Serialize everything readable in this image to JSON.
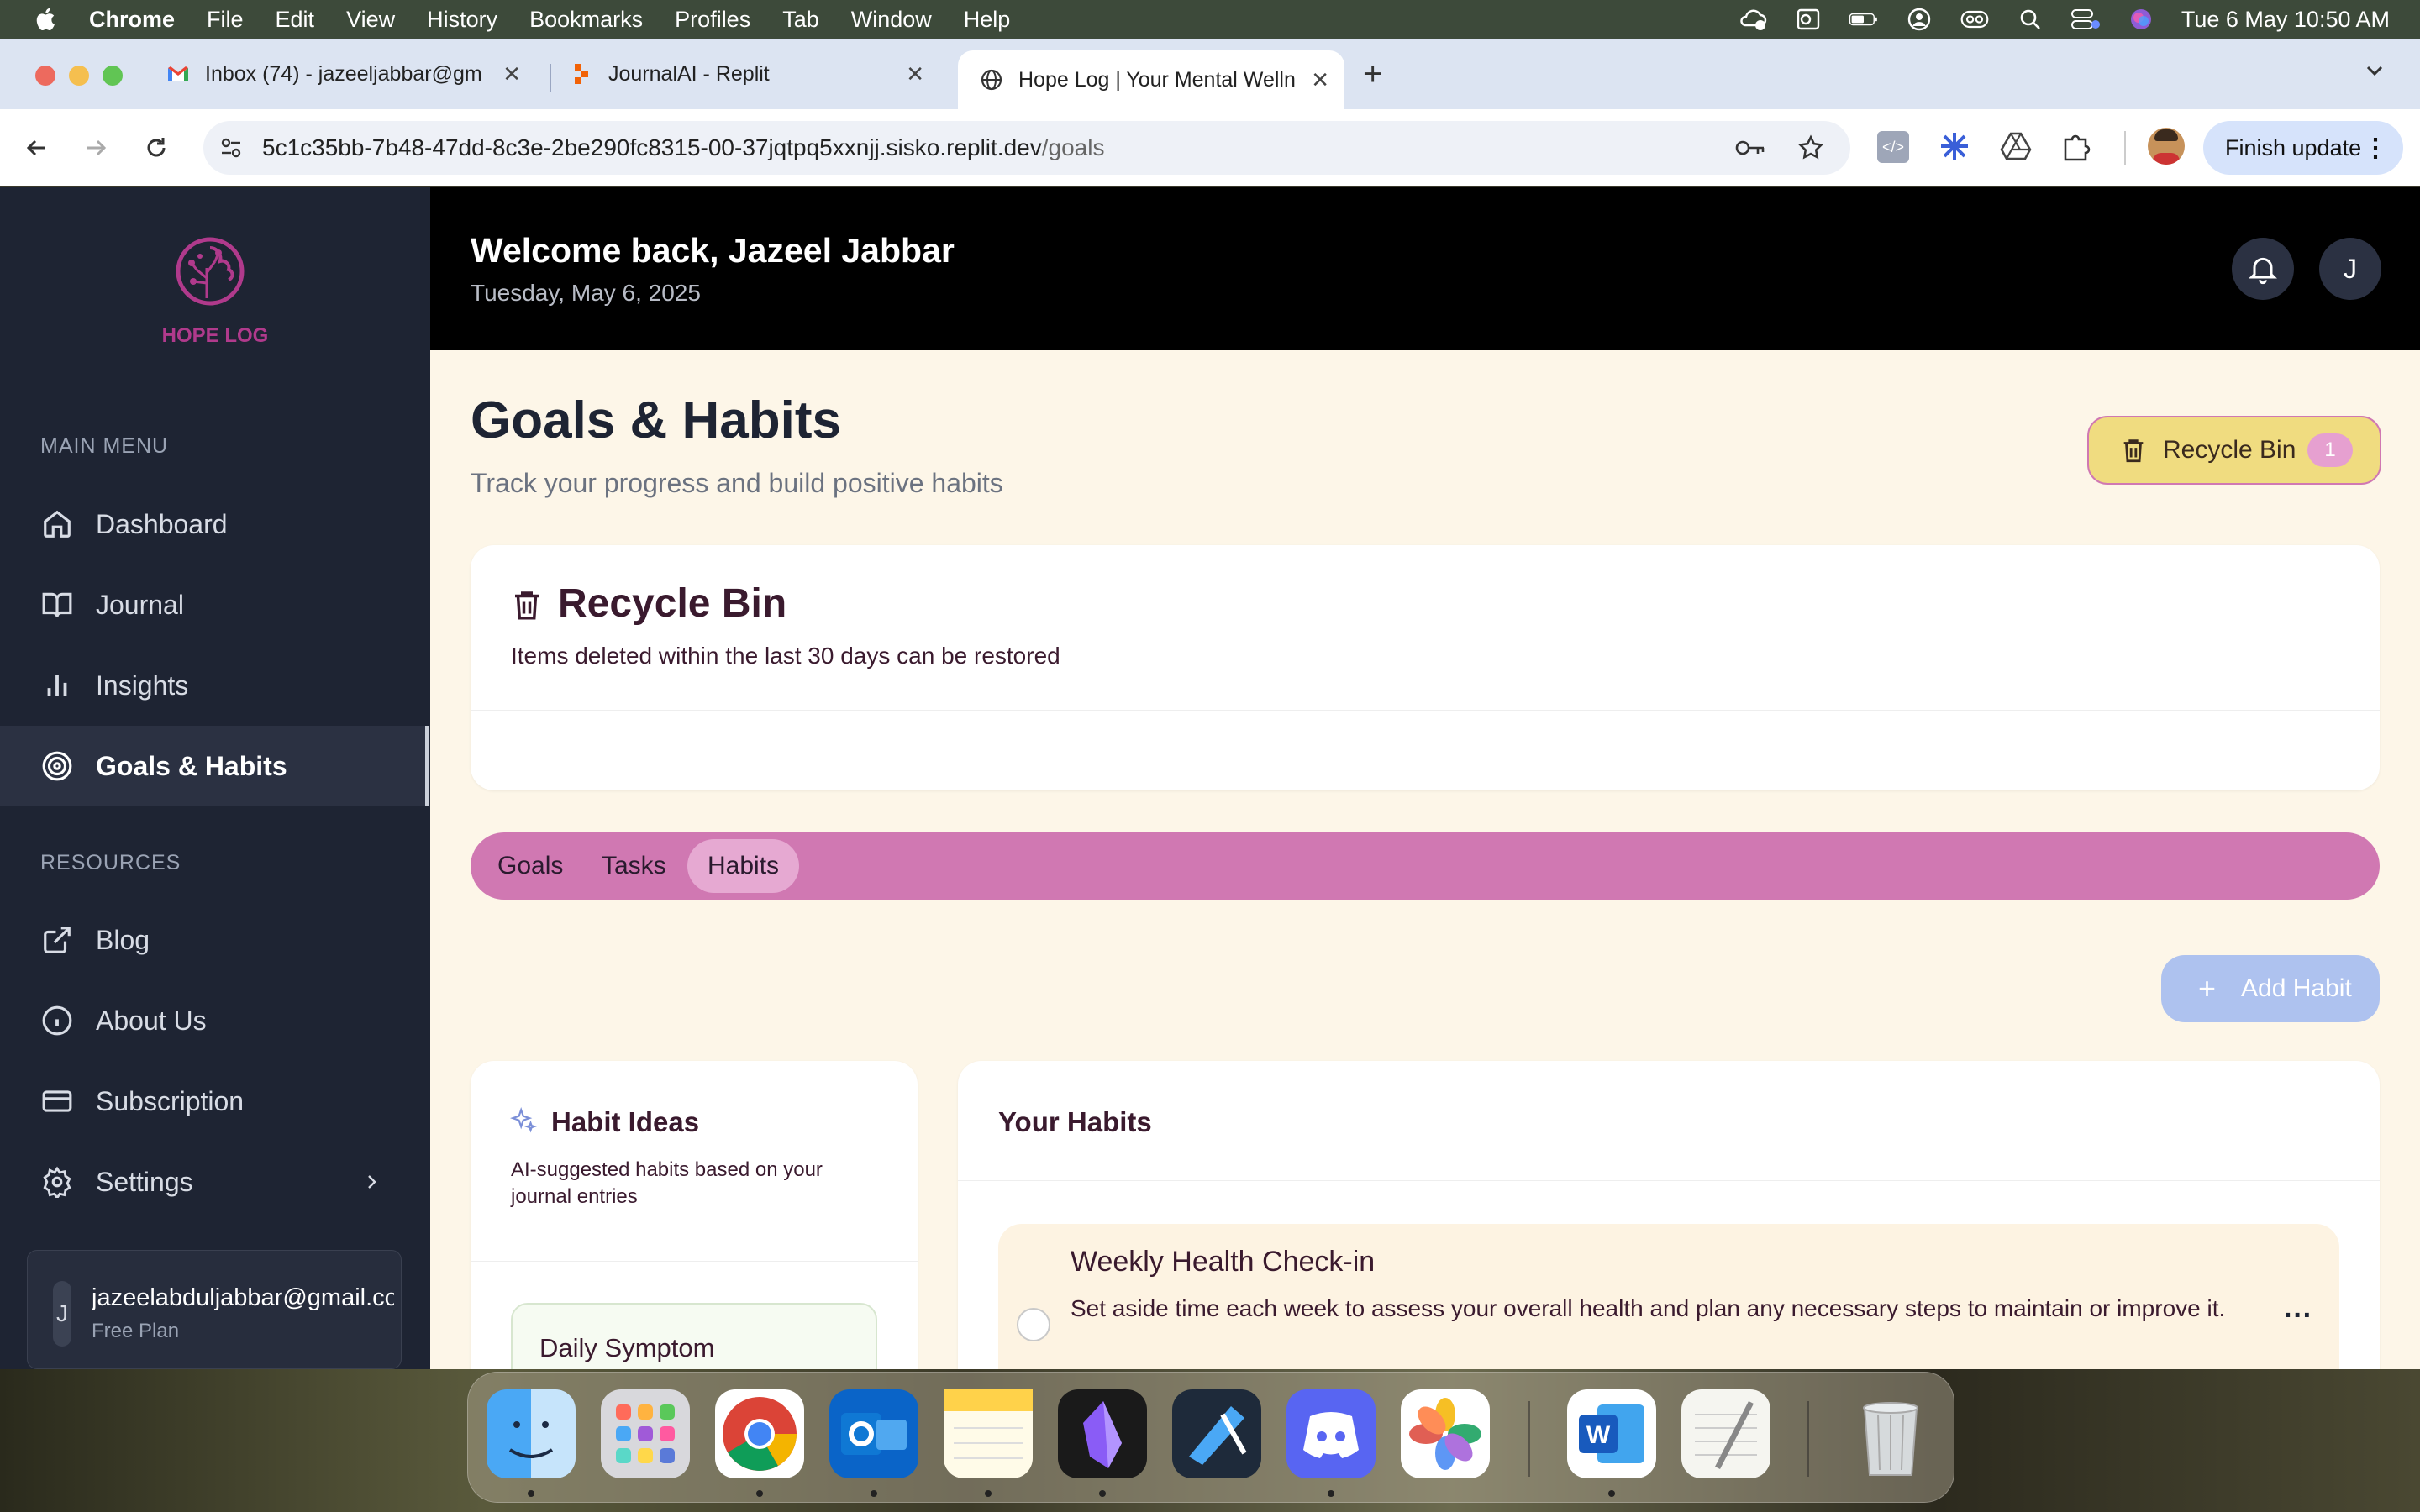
{
  "menubar": {
    "app": "Chrome",
    "items": [
      "File",
      "Edit",
      "View",
      "History",
      "Bookmarks",
      "Profiles",
      "Tab",
      "Window",
      "Help"
    ],
    "datetime": "Tue 6 May  10:50 AM"
  },
  "browser": {
    "tabs": [
      {
        "title": "Inbox (74) - jazeeljabbar@gm",
        "icon": "gmail-icon"
      },
      {
        "title": "JournalAI - Replit",
        "icon": "replit-icon"
      },
      {
        "title": "Hope Log | Your Mental Welln",
        "icon": "globe-icon"
      }
    ],
    "url_host": "5c1c35bb-7b48-47dd-8c3e-2be290fc8315-00-37jqtpq5xxnjj.sisko.replit.dev",
    "url_path": "/goals",
    "finish_update": "Finish update"
  },
  "sidebar": {
    "brand": "HOPE LOG",
    "main_menu_title": "MAIN MENU",
    "main_items": [
      {
        "label": "Dashboard",
        "icon": "home-icon"
      },
      {
        "label": "Journal",
        "icon": "book-icon"
      },
      {
        "label": "Insights",
        "icon": "bar-chart-icon"
      },
      {
        "label": "Goals & Habits",
        "icon": "target-icon",
        "active": true
      }
    ],
    "resources_title": "RESOURCES",
    "resource_items": [
      {
        "label": "Blog",
        "icon": "external-link-icon"
      },
      {
        "label": "About Us",
        "icon": "info-icon"
      },
      {
        "label": "Subscription",
        "icon": "credit-card-icon"
      },
      {
        "label": "Settings",
        "icon": "gear-icon"
      }
    ],
    "user": {
      "initial": "J",
      "email": "jazeelabduljabbar@gmail.com",
      "plan": "Free Plan"
    }
  },
  "header": {
    "welcome": "Welcome back, Jazeel Jabbar",
    "date": "Tuesday, May 6, 2025",
    "avatar_initial": "J"
  },
  "page": {
    "title": "Goals & Habits",
    "subtitle": "Track your progress and build positive habits",
    "recycle_button": "Recycle Bin",
    "recycle_count": "1"
  },
  "recycle_card": {
    "title": "Recycle Bin",
    "description": "Items deleted within the last 30 days can be restored"
  },
  "tabs": {
    "items": [
      "Goals",
      "Tasks",
      "Habits"
    ],
    "active": "Habits"
  },
  "add_habit": "Add Habit",
  "habit_ideas": {
    "title": "Habit Ideas",
    "description": "AI-suggested habits based on your journal entries",
    "first_idea": "Daily Symptom Monitoring"
  },
  "your_habits": {
    "title": "Your Habits",
    "items": [
      {
        "name": "Weekly Health Check-in",
        "description": "Set aside time each week to assess your overall health and plan any necessary steps to maintain or improve it."
      }
    ]
  },
  "colors": {
    "sidebar": "#1e2433",
    "accent_pink": "#d078b2",
    "recycle_yellow": "#f0dc80",
    "brand": "#b03a8c"
  }
}
